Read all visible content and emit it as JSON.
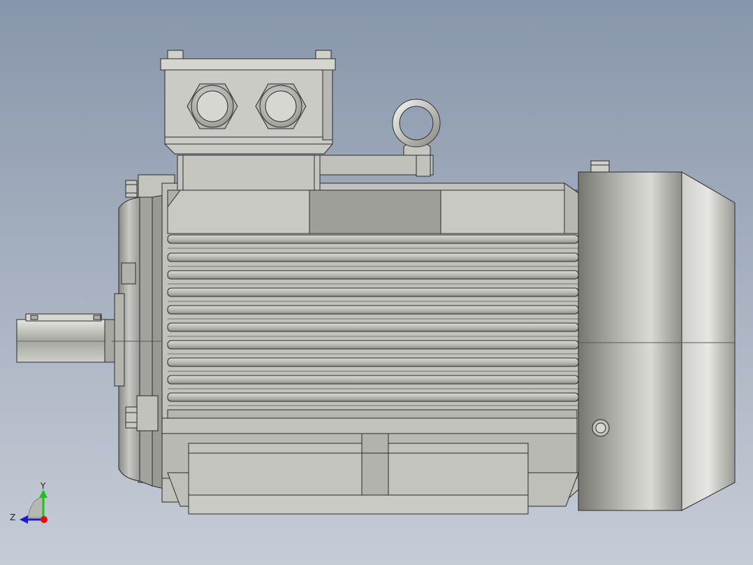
{
  "viewport": {
    "background_top": "#8896ab",
    "background_bottom": "#c6ccd6"
  },
  "model": {
    "body_color": "#bcbcb6",
    "edge_color": "#2a2a2a",
    "fan_cover_color": "#9e9e98"
  },
  "triad": {
    "y_label": "Y",
    "z_label": "Z",
    "y_color": "#19c419",
    "z_color": "#1a1ad8",
    "x_color": "#e01010"
  }
}
